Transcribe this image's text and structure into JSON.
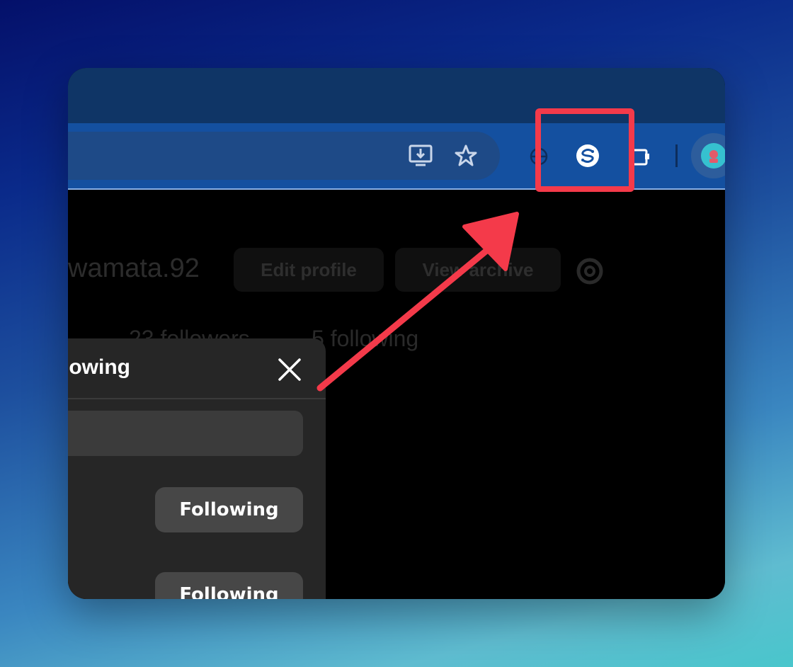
{
  "browser": {
    "toolbar_icons": [
      "install-app-icon",
      "bookmark-star-icon",
      "extension-logo-icon",
      "extensions-puzzle-icon",
      "profile-avatar-icon"
    ]
  },
  "profile": {
    "username": "wamata.92",
    "edit_profile_label": "Edit profile",
    "view_archive_label": "View archive",
    "followers": "23 followers",
    "following": "5 following"
  },
  "modal": {
    "title": "Following",
    "items": [
      {
        "button_label": "Following"
      },
      {
        "button_label": "Following"
      }
    ]
  },
  "annotation": {
    "highlight_color": "#f43a4a"
  }
}
